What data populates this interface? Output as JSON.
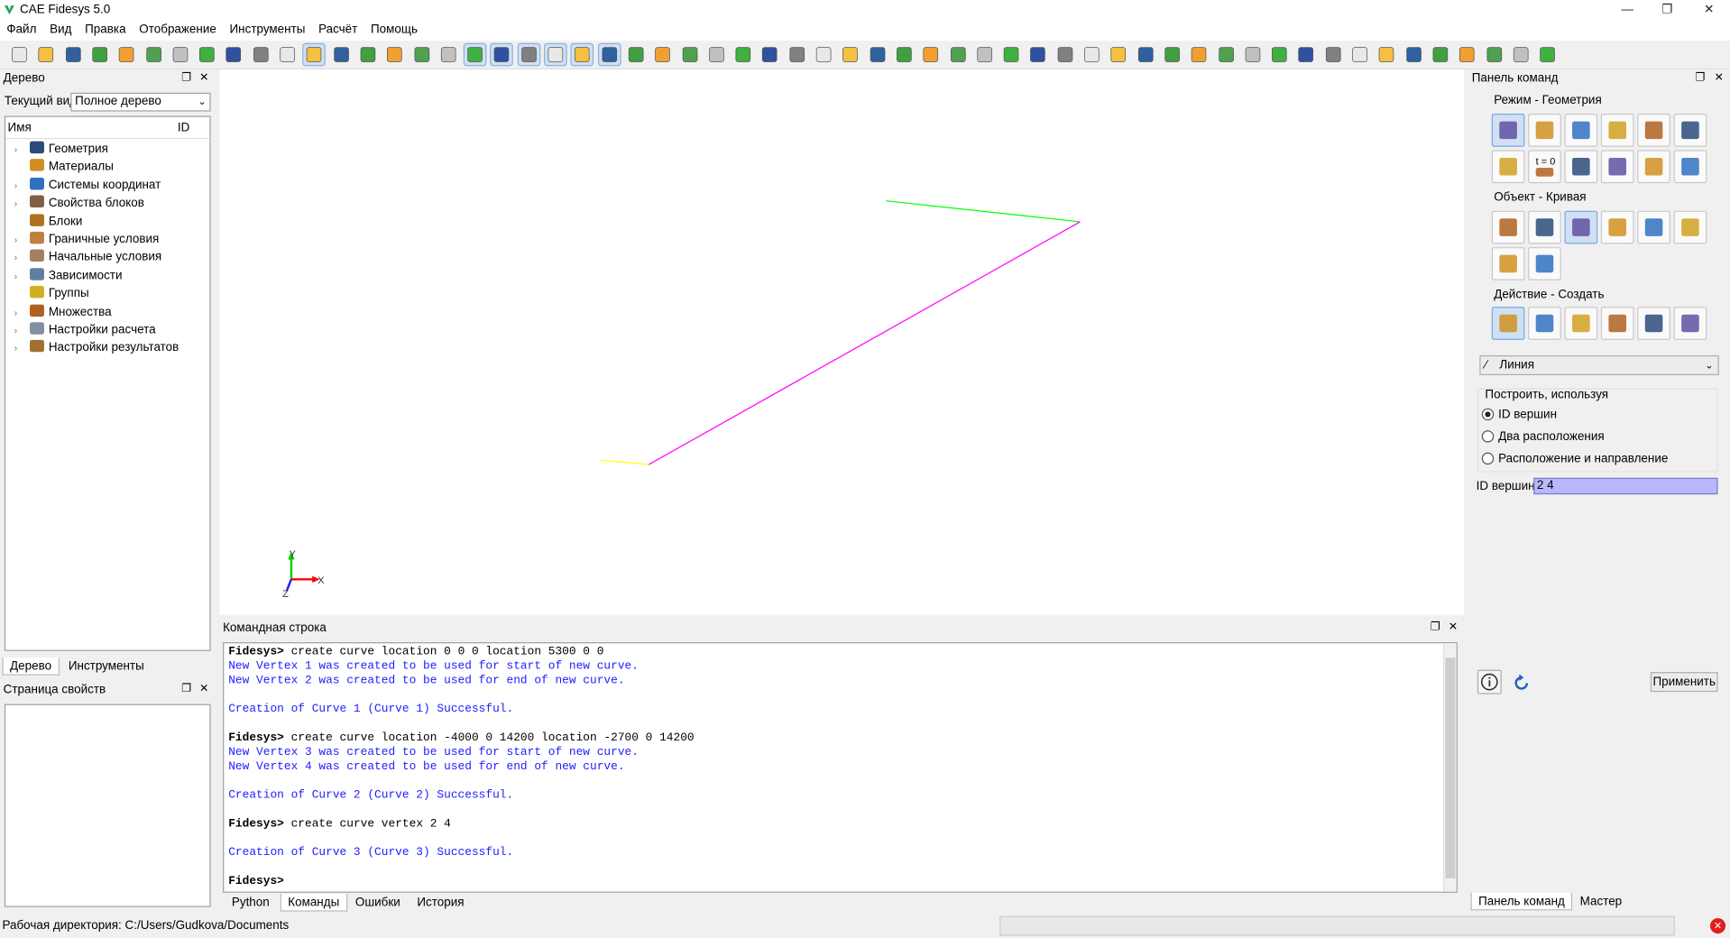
{
  "window": {
    "title": "CAE Fidesys 5.0"
  },
  "menu": [
    "Файл",
    "Вид",
    "Правка",
    "Отображение",
    "Инструменты",
    "Расчёт",
    "Помощь"
  ],
  "tree_panel": {
    "title": "Дерево",
    "view_label": "Текущий вид",
    "view_value": "Полное дерево",
    "col_name": "Имя",
    "col_id": "ID",
    "items": [
      {
        "label": "Геометрия",
        "expandable": true,
        "color": "#2a4a7a"
      },
      {
        "label": "Материалы",
        "expandable": false,
        "color": "#d09020"
      },
      {
        "label": "Системы координат",
        "expandable": true,
        "color": "#3070c0"
      },
      {
        "label": "Свойства блоков",
        "expandable": true,
        "color": "#806040"
      },
      {
        "label": "Блоки",
        "expandable": false,
        "color": "#b07020"
      },
      {
        "label": "Граничные условия",
        "expandable": true,
        "color": "#c08040"
      },
      {
        "label": "Начальные условия",
        "expandable": true,
        "color": "#a08060"
      },
      {
        "label": "Зависимости",
        "expandable": true,
        "color": "#6080a0"
      },
      {
        "label": "Группы",
        "expandable": false,
        "color": "#d0b020"
      },
      {
        "label": "Множества",
        "expandable": true,
        "color": "#b06020"
      },
      {
        "label": "Настройки расчета",
        "expandable": true,
        "color": "#8090a0"
      },
      {
        "label": "Настройки результатов",
        "expandable": true,
        "color": "#a07030"
      }
    ],
    "tabs": [
      "Дерево",
      "Инструменты"
    ]
  },
  "props_panel": {
    "title": "Страница свойств"
  },
  "viewport": {
    "axis_y": "Y",
    "axis_x": "X",
    "axis_z": "Z"
  },
  "console": {
    "title": "Командная строка",
    "lines": [
      {
        "type": "cmd",
        "prompt": "Fidesys>",
        "text": " create curve location 0 0 0 location 5300 0 0"
      },
      {
        "type": "info",
        "text": "New Vertex 1 was created to be used for start of new curve."
      },
      {
        "type": "info",
        "text": "New Vertex 2 was created to be used for end of new curve."
      },
      {
        "type": "blank",
        "text": ""
      },
      {
        "type": "info",
        "text": "Creation of Curve 1 (Curve 1) Successful."
      },
      {
        "type": "blank",
        "text": ""
      },
      {
        "type": "cmd",
        "prompt": "Fidesys>",
        "text": " create curve location -4000 0 14200 location -2700 0 14200"
      },
      {
        "type": "info",
        "text": "New Vertex 3 was created to be used for start of new curve."
      },
      {
        "type": "info",
        "text": "New Vertex 4 was created to be used for end of new curve."
      },
      {
        "type": "blank",
        "text": ""
      },
      {
        "type": "info",
        "text": "Creation of Curve 2 (Curve 2) Successful."
      },
      {
        "type": "blank",
        "text": ""
      },
      {
        "type": "cmd",
        "prompt": "Fidesys>",
        "text": " create curve vertex 2 4"
      },
      {
        "type": "blank",
        "text": ""
      },
      {
        "type": "info",
        "text": "Creation of Curve 3 (Curve 3) Successful."
      },
      {
        "type": "blank",
        "text": ""
      },
      {
        "type": "cmd",
        "prompt": "Fidesys>",
        "text": ""
      }
    ],
    "tabs": [
      "Python",
      "Команды",
      "Ошибки",
      "История"
    ],
    "active_tab": "Команды"
  },
  "command_panel": {
    "title": "Панель команд",
    "mode_label": "Режим - Геометрия",
    "mode_t0": "t = 0",
    "object_label": "Объект - Кривая",
    "action_label": "Действие - Создать",
    "type_value": "Линия",
    "build_label": "Построить, используя",
    "options": [
      "ID вершин",
      "Два расположения",
      "Расположение и направление"
    ],
    "selected_option": 0,
    "vertex_id_label": "ID вершин",
    "vertex_id_value": "2 4",
    "apply_label": "Применить",
    "tabs": [
      "Панель команд",
      "Мастер"
    ]
  },
  "status": {
    "workdir": "Рабочая директория: C:/Users/Gudkova/Documents"
  },
  "colors": {
    "curve1": "#ffff00",
    "curve2": "#00ff00",
    "curve3": "#ff00ff",
    "selection": "#b8b8ff"
  }
}
